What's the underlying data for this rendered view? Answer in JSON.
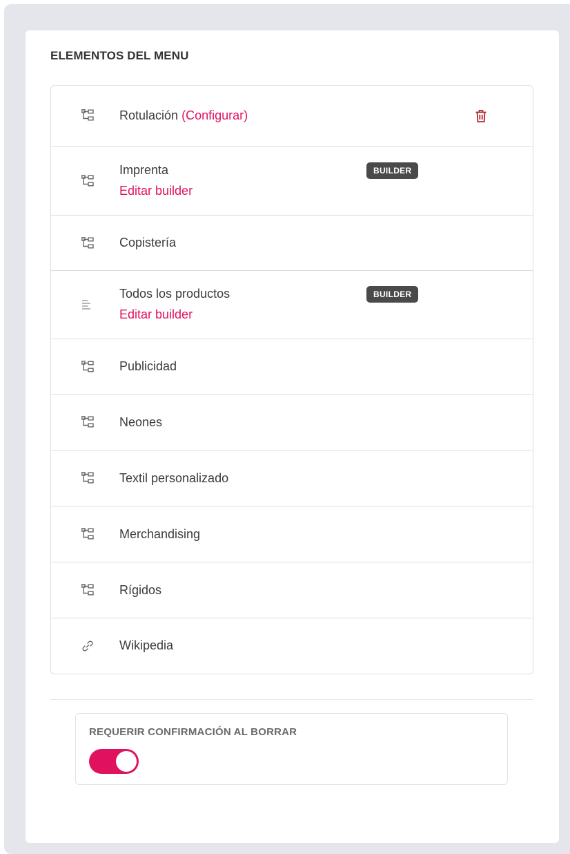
{
  "section": {
    "title": "ELEMENTOS DEL MENU"
  },
  "menu": {
    "items": [
      {
        "label": "Rotulación",
        "icon": "sitemap-icon",
        "configure_label": "(Configurar)",
        "has_delete": true
      },
      {
        "label": "Imprenta",
        "icon": "sitemap-icon",
        "badge": "BUILDER",
        "edit_label": "Editar builder"
      },
      {
        "label": "Copistería",
        "icon": "sitemap-icon"
      },
      {
        "label": "Todos los productos",
        "icon": "align-left-icon",
        "badge": "BUILDER",
        "edit_label": "Editar builder"
      },
      {
        "label": "Publicidad",
        "icon": "sitemap-icon"
      },
      {
        "label": "Neones",
        "icon": "sitemap-icon"
      },
      {
        "label": "Textil personalizado",
        "icon": "sitemap-icon"
      },
      {
        "label": "Merchandising",
        "icon": "sitemap-icon"
      },
      {
        "label": "Rígidos",
        "icon": "sitemap-icon"
      },
      {
        "label": "Wikipedia",
        "icon": "link-icon"
      }
    ]
  },
  "confirm_delete": {
    "label": "REQUERIR CONFIRMACIÓN AL BORRAR",
    "enabled": true
  },
  "colors": {
    "accent": "#e0115f",
    "delete": "#b3272e",
    "badge_bg": "#4a4a4a",
    "page_bg": "#e4e6ec"
  }
}
